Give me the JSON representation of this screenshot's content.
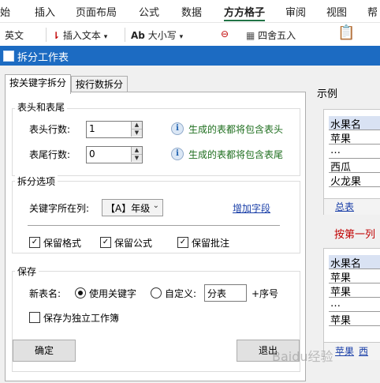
{
  "ribbon": {
    "tabs": [
      "始",
      "插入",
      "页面布局",
      "公式",
      "数据",
      "方方格子",
      "审阅",
      "视图",
      "帮"
    ],
    "active_tab": "方方格子",
    "tools": {
      "english": "英文",
      "insert_text": "插入文本",
      "case": "大小写",
      "round": "四舍五入"
    },
    "accent_color": "#217346"
  },
  "dialog": {
    "title": "拆分工作表",
    "tabs": [
      "按关键字拆分",
      "按行数拆分"
    ],
    "header_footer": {
      "title": "表头和表尾",
      "header_rows_label": "表头行数:",
      "header_rows_value": "1",
      "footer_rows_label": "表尾行数:",
      "footer_rows_value": "0",
      "header_hint": "生成的表都将包含表头",
      "footer_hint": "生成的表都将包含表尾"
    },
    "split_options": {
      "title": "拆分选项",
      "keyword_column_label": "关键字所在列:",
      "keyword_column_value": "【A】年级",
      "add_field_link": "增加字段",
      "keep_format": "保留格式",
      "keep_formula": "保留公式",
      "keep_comment": "保留批注",
      "checks": {
        "format": true,
        "formula": true,
        "comment": true
      }
    },
    "save": {
      "title": "保存",
      "new_sheet_name_label": "新表名:",
      "use_keyword_label": "使用关键字",
      "custom_label": "自定义:",
      "custom_value": "分表",
      "serial_suffix": "+序号",
      "selected": "use_keyword",
      "save_as_workbook_label": "保存为独立工作簿",
      "save_as_workbook_checked": false
    },
    "ok_button": "确定",
    "exit_button": "退出"
  },
  "example": {
    "title": "示例",
    "top_table": {
      "header": "水果名",
      "rows": [
        "苹果",
        "…",
        "西瓜",
        "火龙果"
      ],
      "sheet_tab": "总表"
    },
    "caption": "按第一列",
    "bottom_table": {
      "header": "水果名",
      "rows": [
        "苹果",
        "苹果",
        "…",
        "苹果"
      ],
      "sheet_tabs": [
        "苹果",
        "西"
      ]
    }
  },
  "watermark": "Baidu经验"
}
